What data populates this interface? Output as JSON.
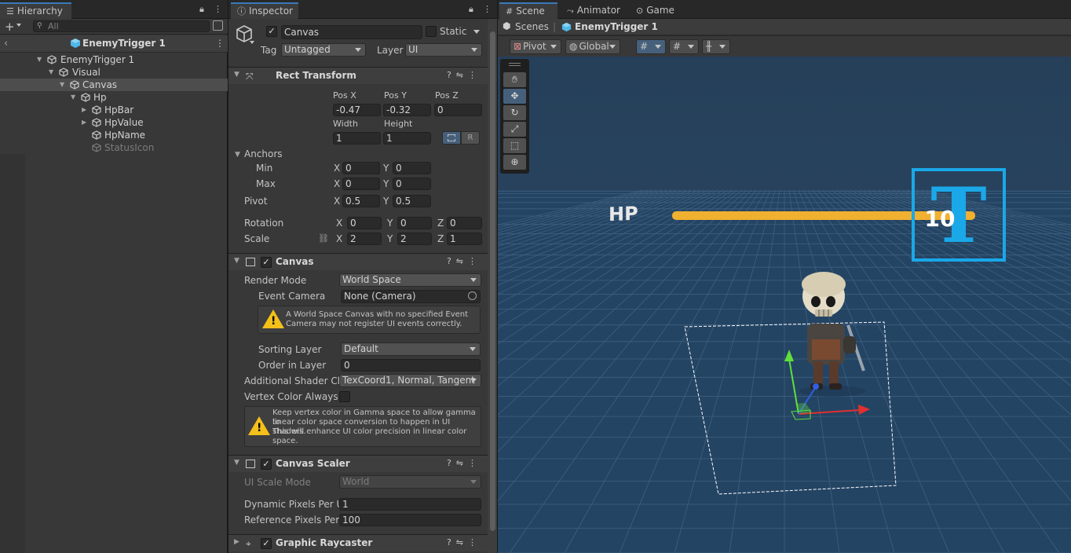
{
  "hierarchy": {
    "tab_label": "Hierarchy",
    "search_placeholder": "All",
    "scene_header": "EnemyTrigger 1",
    "items": [
      {
        "label": "EnemyTrigger 1"
      },
      {
        "label": "Visual"
      },
      {
        "label": "Canvas"
      },
      {
        "label": "Hp"
      },
      {
        "label": "HpBar"
      },
      {
        "label": "HpValue"
      },
      {
        "label": "HpName"
      },
      {
        "label": "StatusIcon"
      }
    ]
  },
  "inspector": {
    "tab_label": "Inspector",
    "object_name": "Canvas",
    "static_label": "Static",
    "tag_label": "Tag",
    "tag_value": "Untagged",
    "layer_label": "Layer",
    "layer_value": "UI",
    "rect_transform": {
      "title": "Rect Transform",
      "pos_x_label": "Pos X",
      "pos_y_label": "Pos Y",
      "pos_z_label": "Pos Z",
      "pos_x": "-0.47",
      "pos_y": "-0.32",
      "pos_z": "0",
      "width_label": "Width",
      "height_label": "Height",
      "width": "1",
      "height": "1",
      "raw_btn": "R",
      "anchors_label": "Anchors",
      "min_label": "Min",
      "max_label": "Max",
      "anchor_min_x": "0",
      "anchor_min_y": "0",
      "anchor_max_x": "0",
      "anchor_max_y": "0",
      "pivot_label": "Pivot",
      "pivot_x": "0.5",
      "pivot_y": "0.5",
      "rotation_label": "Rotation",
      "rot_x": "0",
      "rot_y": "0",
      "rot_z": "0",
      "scale_label": "Scale",
      "scale_x": "2",
      "scale_y": "2",
      "scale_z": "1",
      "x": "X",
      "y": "Y",
      "z": "Z"
    },
    "canvas": {
      "title": "Canvas",
      "render_mode_label": "Render Mode",
      "render_mode": "World Space",
      "event_camera_label": "Event Camera",
      "event_camera": "None (Camera)",
      "warning_line1": "A World Space Canvas with no specified Event",
      "warning_line2": "Camera may not register UI events correctly.",
      "sorting_layer_label": "Sorting Layer",
      "sorting_layer": "Default",
      "order_label": "Order in Layer",
      "order": "0",
      "shader_ch_label": "Additional Shader Ch",
      "shader_ch": "TexCoord1, Normal, Tangent",
      "vertex_color_label": "Vertex Color Always I",
      "info_line1": "Keep vertex color in Gamma space to allow gamma to",
      "info_line2": "linear color space conversion to happen in UI shaders.",
      "info_line3": "This will enhance UI color precision in linear color",
      "info_line4": "space."
    },
    "canvas_scaler": {
      "title": "Canvas Scaler",
      "ui_scale_mode_label": "UI Scale Mode",
      "ui_scale_mode": "World",
      "dynamic_label": "Dynamic Pixels Per U",
      "dynamic": "1",
      "reference_label": "Reference Pixels Per",
      "reference": "100"
    },
    "graphic_raycaster": {
      "title": "Graphic Raycaster"
    }
  },
  "scene": {
    "tabs": [
      {
        "label": "Scene"
      },
      {
        "label": "Animator"
      },
      {
        "label": "Game"
      }
    ],
    "breadcrumb_root": "Scenes",
    "breadcrumb_current": "EnemyTrigger 1",
    "pivot_btn": "Pivot",
    "global_btn": "Global",
    "hp_text": "HP",
    "hp_value": "10",
    "hp_fill": 1.0,
    "status_icon_letter": "T"
  },
  "colors": {
    "accent": "#3a79bb",
    "hp_bar": "#f0b030",
    "status_icon": "#1aa8e8",
    "scene_bg": "#243a52"
  }
}
